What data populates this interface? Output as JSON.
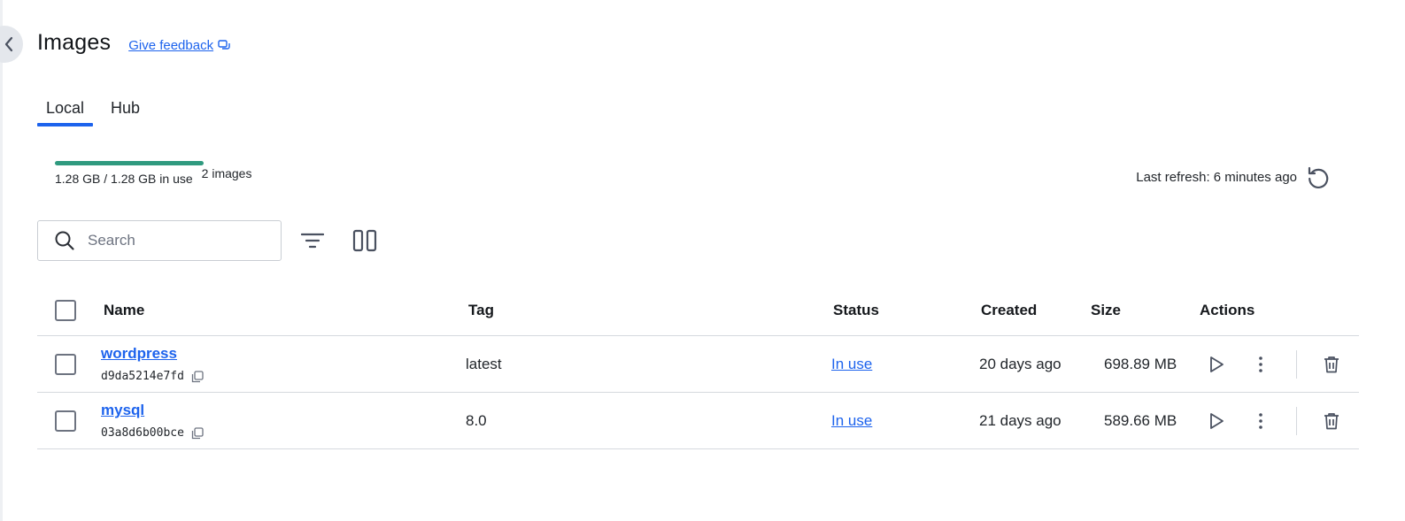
{
  "header": {
    "title": "Images",
    "feedback_label": "Give feedback"
  },
  "tabs": [
    {
      "label": "Local",
      "active": true
    },
    {
      "label": "Hub",
      "active": false
    }
  ],
  "usage": {
    "text": "1.28 GB / 1.28 GB in use",
    "fill_percent": 100,
    "count": "2 images"
  },
  "refresh": {
    "label": "Last refresh: 6 minutes ago"
  },
  "search": {
    "placeholder": "Search"
  },
  "table": {
    "columns": [
      "Name",
      "Tag",
      "Status",
      "Created",
      "Size",
      "Actions"
    ],
    "rows": [
      {
        "name": "wordpress",
        "id": "d9da5214e7fd",
        "tag": "latest",
        "status": "In use",
        "created": "20 days ago",
        "size": "698.89 MB"
      },
      {
        "name": "mysql",
        "id": "03a8d6b00bce",
        "tag": "8.0",
        "status": "In use",
        "created": "21 days ago",
        "size": "589.66 MB"
      }
    ]
  },
  "colors": {
    "accent": "#1d63ed",
    "usage_bar": "#2f9a7f"
  },
  "icons": [
    "chevron-left-icon",
    "feedback-icon",
    "refresh-icon",
    "search-icon",
    "filter-icon",
    "columns-icon",
    "copy-icon",
    "play-icon",
    "more-vertical-icon",
    "trash-icon"
  ]
}
